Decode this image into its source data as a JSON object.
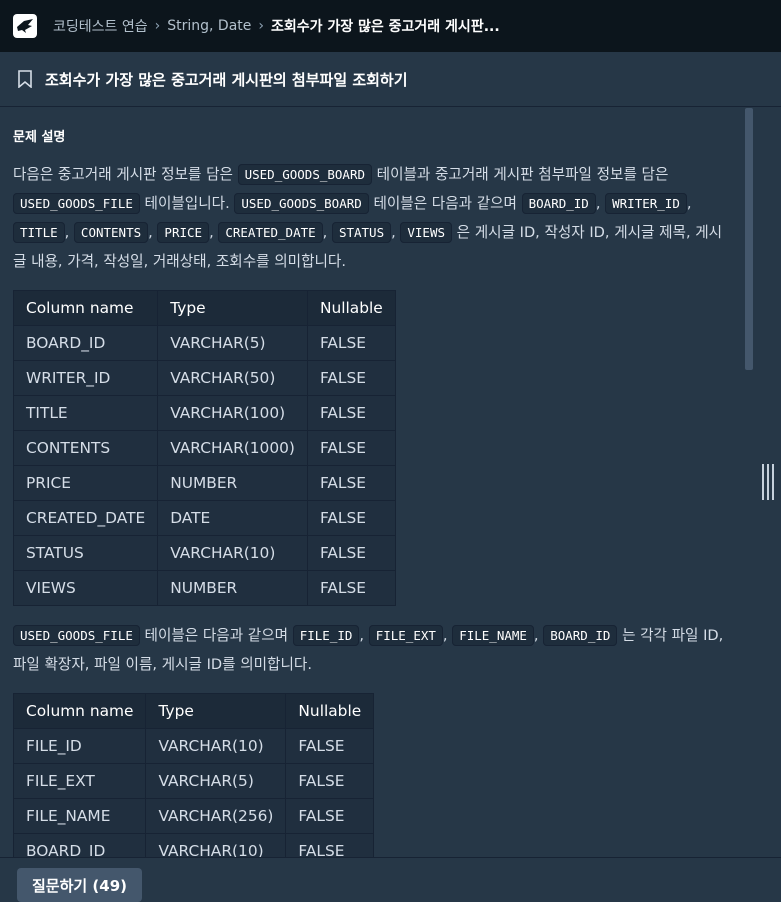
{
  "topbar": {
    "breadcrumbs": [
      "코딩테스트 연습",
      "String, Date",
      "조회수가 가장 많은 중고거래 게시판..."
    ]
  },
  "title": "조회수가 가장 많은 중고거래 게시판의 첨부파일 조회하기",
  "section_heading": "문제 설명",
  "para1": {
    "t1": "다음은 중고거래 게시판 정보를 담은",
    "c1": "USED_GOODS_BOARD",
    "t2": "테이블과 중고거래 게시판 첨부파일 정보를 담은",
    "c2": "USED_GOODS_FILE",
    "t3": "테이블입니다.",
    "c3": "USED_GOODS_BOARD",
    "t4": "테이블은 다음과 같으며",
    "c4": "BOARD_ID",
    "c5": "WRITER_ID",
    "c6": "TITLE",
    "c7": "CONTENTS",
    "c8": "PRICE",
    "c9": "CREATED_DATE",
    "c10": "STATUS",
    "c11": "VIEWS",
    "t5": "은 게시글 ID, 작성자 ID, 게시글 제목, 게시글 내용, 가격, 작성일, 거래상태, 조회수를 의미합니다."
  },
  "table1": {
    "headers": [
      "Column name",
      "Type",
      "Nullable"
    ],
    "rows": [
      [
        "BOARD_ID",
        "VARCHAR(5)",
        "FALSE"
      ],
      [
        "WRITER_ID",
        "VARCHAR(50)",
        "FALSE"
      ],
      [
        "TITLE",
        "VARCHAR(100)",
        "FALSE"
      ],
      [
        "CONTENTS",
        "VARCHAR(1000)",
        "FALSE"
      ],
      [
        "PRICE",
        "NUMBER",
        "FALSE"
      ],
      [
        "CREATED_DATE",
        "DATE",
        "FALSE"
      ],
      [
        "STATUS",
        "VARCHAR(10)",
        "FALSE"
      ],
      [
        "VIEWS",
        "NUMBER",
        "FALSE"
      ]
    ]
  },
  "para2": {
    "c1": "USED_GOODS_FILE",
    "t1": "테이블은 다음과 같으며",
    "c2": "FILE_ID",
    "c3": "FILE_EXT",
    "c4": "FILE_NAME",
    "c5": "BOARD_ID",
    "t2": "는 각각 파일 ID, 파일 확장자, 파일 이름, 게시글 ID를 의미합니다."
  },
  "table2": {
    "headers": [
      "Column name",
      "Type",
      "Nullable"
    ],
    "rows": [
      [
        "FILE_ID",
        "VARCHAR(10)",
        "FALSE"
      ],
      [
        "FILE_EXT",
        "VARCHAR(5)",
        "FALSE"
      ],
      [
        "FILE_NAME",
        "VARCHAR(256)",
        "FALSE"
      ],
      [
        "BOARD_ID",
        "VARCHAR(10)",
        "FALSE"
      ]
    ]
  },
  "question_button": "질문하기 (49)",
  "icons": {
    "logo": "programmers-logo-icon",
    "bookmark": "bookmark-icon",
    "separator": "chevron-right-icon",
    "grip": "resize-handle-icon"
  }
}
